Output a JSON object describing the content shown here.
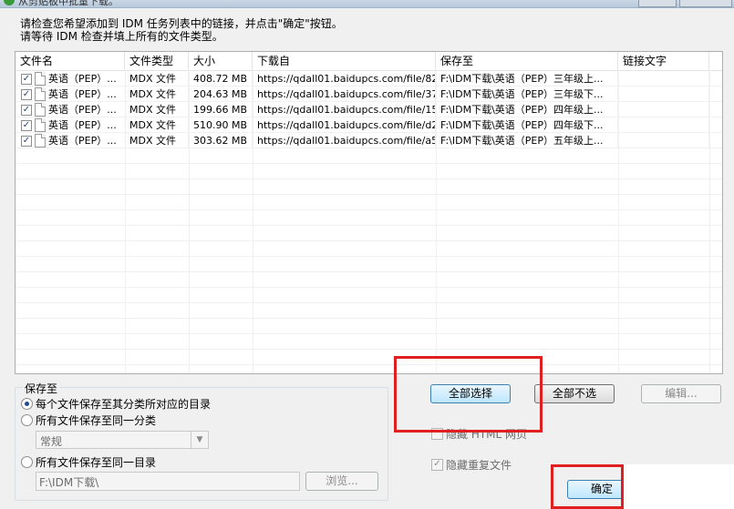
{
  "window": {
    "title": "从剪贴板中批量下载。"
  },
  "instructions": {
    "line1": "请检查您希望添加到 IDM 任务列表中的链接，并点击\"确定\"按钮。",
    "line2": "请等待 IDM 检查并填上所有的文件类型。"
  },
  "columns": [
    "文件名",
    "文件类型",
    "大小",
    "下载自",
    "保存至",
    "链接文字"
  ],
  "rows": [
    {
      "checked": "✓",
      "name": "英语（PEP）...",
      "type": "MDX 文件",
      "size": "408.72 MB",
      "url": "https://qdall01.baidupcs.com/file/82...",
      "save": "F:\\IDM下载\\英语（PEP）三年级上...",
      "link": ""
    },
    {
      "checked": "✓",
      "name": "英语（PEP）...",
      "type": "MDX 文件",
      "size": "204.63 MB",
      "url": "https://qdall01.baidupcs.com/file/37...",
      "save": "F:\\IDM下载\\英语（PEP）三年级下...",
      "link": ""
    },
    {
      "checked": "✓",
      "name": "英语（PEP）...",
      "type": "MDX 文件",
      "size": "199.66 MB",
      "url": "https://qdall01.baidupcs.com/file/15...",
      "save": "F:\\IDM下载\\英语（PEP）四年级上...",
      "link": ""
    },
    {
      "checked": "✓",
      "name": "英语（PEP）...",
      "type": "MDX 文件",
      "size": "510.90 MB",
      "url": "https://qdall01.baidupcs.com/file/d2...",
      "save": "F:\\IDM下载\\英语（PEP）四年级下...",
      "link": ""
    },
    {
      "checked": "✓",
      "name": "英语（PEP）...",
      "type": "MDX 文件",
      "size": "303.62 MB",
      "url": "https://qdall01.baidupcs.com/file/a5...",
      "save": "F:\\IDM下载\\英语（PEP）五年级上...",
      "link": ""
    }
  ],
  "save_group": {
    "legend": "保存至",
    "option1": "每个文件保存至其分类所对应的目录",
    "option2": "所有文件保存至同一分类",
    "category_value": "常规",
    "option3": "所有文件保存至同一目录",
    "path_value": "F:\\IDM下载\\",
    "browse_label": "浏览..."
  },
  "buttons": {
    "select_all": "全部选择",
    "select_none": "全部不选",
    "edit": "编辑...",
    "ok": "确定"
  },
  "checkboxes": {
    "hide_html": "隐藏 HTML 网页",
    "hide_dup": "隐藏重复文件",
    "hide_dup_mark": "✓"
  },
  "colors": {
    "highlight_box": "#e02020",
    "accent": "#3c7fb1"
  },
  "icons": {
    "app": "idm-icon",
    "file": "file-icon",
    "combo": "chevron-down-icon"
  }
}
